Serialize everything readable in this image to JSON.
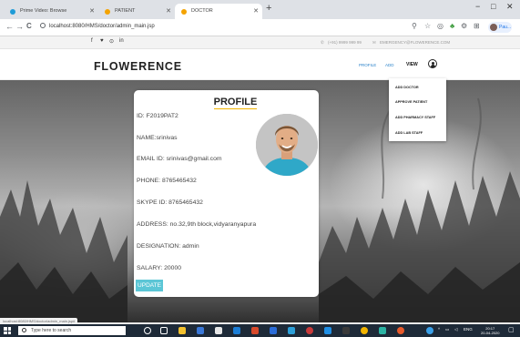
{
  "browser": {
    "tabs": [
      {
        "label": "Prime Video: Browse",
        "active": false
      },
      {
        "label": "PATIENT",
        "active": false
      },
      {
        "label": "DOCTOR",
        "active": true
      }
    ],
    "new_tab": "+",
    "window_controls": {
      "minimize": "−",
      "maximize": "□",
      "close": "✕"
    },
    "nav": {
      "back": "←",
      "forward": "→",
      "reload": "C"
    },
    "url": "localhost:8080/HMS/doctor/admin_main.jsp",
    "profile_label": "Pau..."
  },
  "site": {
    "topbar": {
      "social": [
        "f",
        "♥",
        "⊙",
        "in"
      ],
      "phone": "(+91) 9999 999 99",
      "email": "EMERGENCY@FLOWERENCE.COM"
    },
    "brand": "FLOWERENCE",
    "nav": {
      "profile": "PROFILE",
      "add": "ADD",
      "view": "VIEW"
    },
    "dropdown": [
      "ADD DOCTOR",
      "APPROVE PATIENT",
      "ADD PHARMACY STAFF",
      "ADD LAB STAFF"
    ]
  },
  "profile": {
    "title": "PROFILE",
    "fields": [
      "ID: F2019PAT2",
      "NAME:srinivas",
      "EMAIL ID: srinivas@gmail.com",
      "PHONE: 8765465432",
      "SKYPE ID: 8765465432",
      "ADDRESS: no.32,9th block,vidyaranyapura",
      "DESIGNATION: admin",
      "SALARY: 20000"
    ],
    "update_label": "UPDATE"
  },
  "statusbar": "localhost:8080/HMS/doctor/admin_main.jsp#",
  "taskbar": {
    "search_placeholder": "Type here to search",
    "tray_text": "ENG",
    "time": "20:17",
    "date": "20-04-2020"
  },
  "colors": {
    "accent": "#5bc6d6",
    "title_underline": "#f2b400",
    "link": "#2a82c9",
    "taskbar": "#1e2a38"
  }
}
